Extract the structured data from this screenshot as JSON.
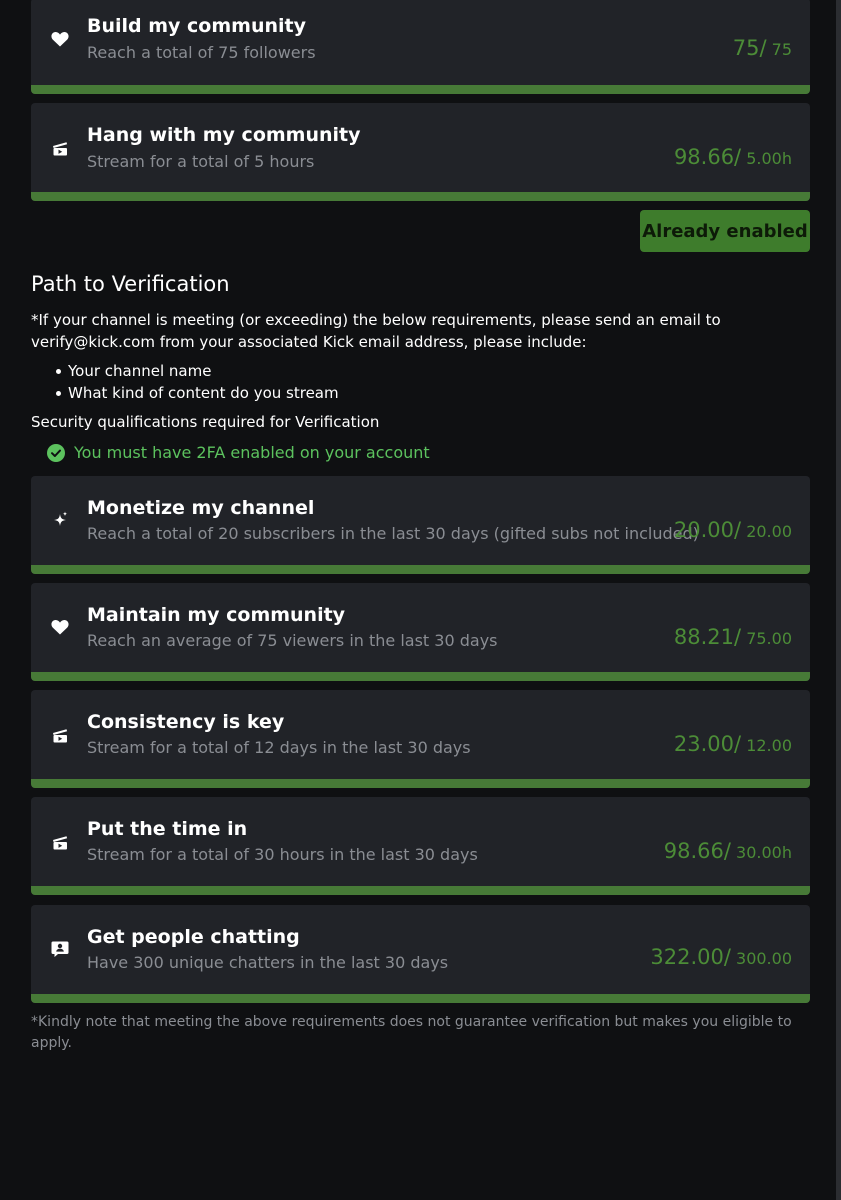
{
  "top_requirements": [
    {
      "icon": "heart-icon",
      "title": "Build my community",
      "description": "Reach a total of 75 followers",
      "current": "75/",
      "total": "75",
      "progress_fraction": 1.0
    },
    {
      "icon": "clapperboard-icon",
      "title": "Hang with my community",
      "description": "Stream for a total of 5 hours",
      "current": "98.66/",
      "total": "5.00h",
      "progress_fraction": 1.0
    }
  ],
  "status_button": {
    "label": "Already enabled"
  },
  "verification": {
    "title": "Path to Verification",
    "notice": "*If your channel is meeting (or exceeding) the below requirements, please send an email to verify@kick.com from your associated Kick email address, please include:",
    "bullets": [
      "Your channel name",
      "What kind of content do you stream"
    ],
    "security_label": "Security qualifications required for Verification",
    "twofa_text": "You must have 2FA enabled on your account",
    "requirements": [
      {
        "icon": "sparkle-icon",
        "title": "Monetize my channel",
        "description": "Reach a total of 20 subscribers in the last 30 days (gifted subs not included)",
        "current": "20.00/",
        "total": "20.00",
        "progress_fraction": 1.0
      },
      {
        "icon": "heart-icon",
        "title": "Maintain my community",
        "description": "Reach an average of 75 viewers in the last 30 days",
        "current": "88.21/",
        "total": "75.00",
        "progress_fraction": 1.0
      },
      {
        "icon": "clapperboard-icon",
        "title": "Consistency is key",
        "description": "Stream for a total of 12 days in the last 30 days",
        "current": "23.00/",
        "total": "12.00",
        "progress_fraction": 1.0
      },
      {
        "icon": "clapperboard-icon",
        "title": "Put the time in",
        "description": "Stream for a total of 30 hours in the last 30 days",
        "current": "98.66/",
        "total": "30.00h",
        "progress_fraction": 1.0
      },
      {
        "icon": "chat-user-icon",
        "title": "Get people chatting",
        "description": "Have 300 unique chatters in the last 30 days",
        "current": "322.00/",
        "total": "300.00",
        "progress_fraction": 1.0
      }
    ],
    "footnote": "*Kindly note that meeting the above requirements does not guarantee verification but makes you eligible to apply."
  },
  "colors": {
    "background": "#0f1012",
    "card": "#212328",
    "accent_green": "#53a03e",
    "progress_text": "#4c8c37",
    "button_bg": "#3e7c2c",
    "success_text": "#5cc25e",
    "muted_text": "#8a8d93"
  }
}
